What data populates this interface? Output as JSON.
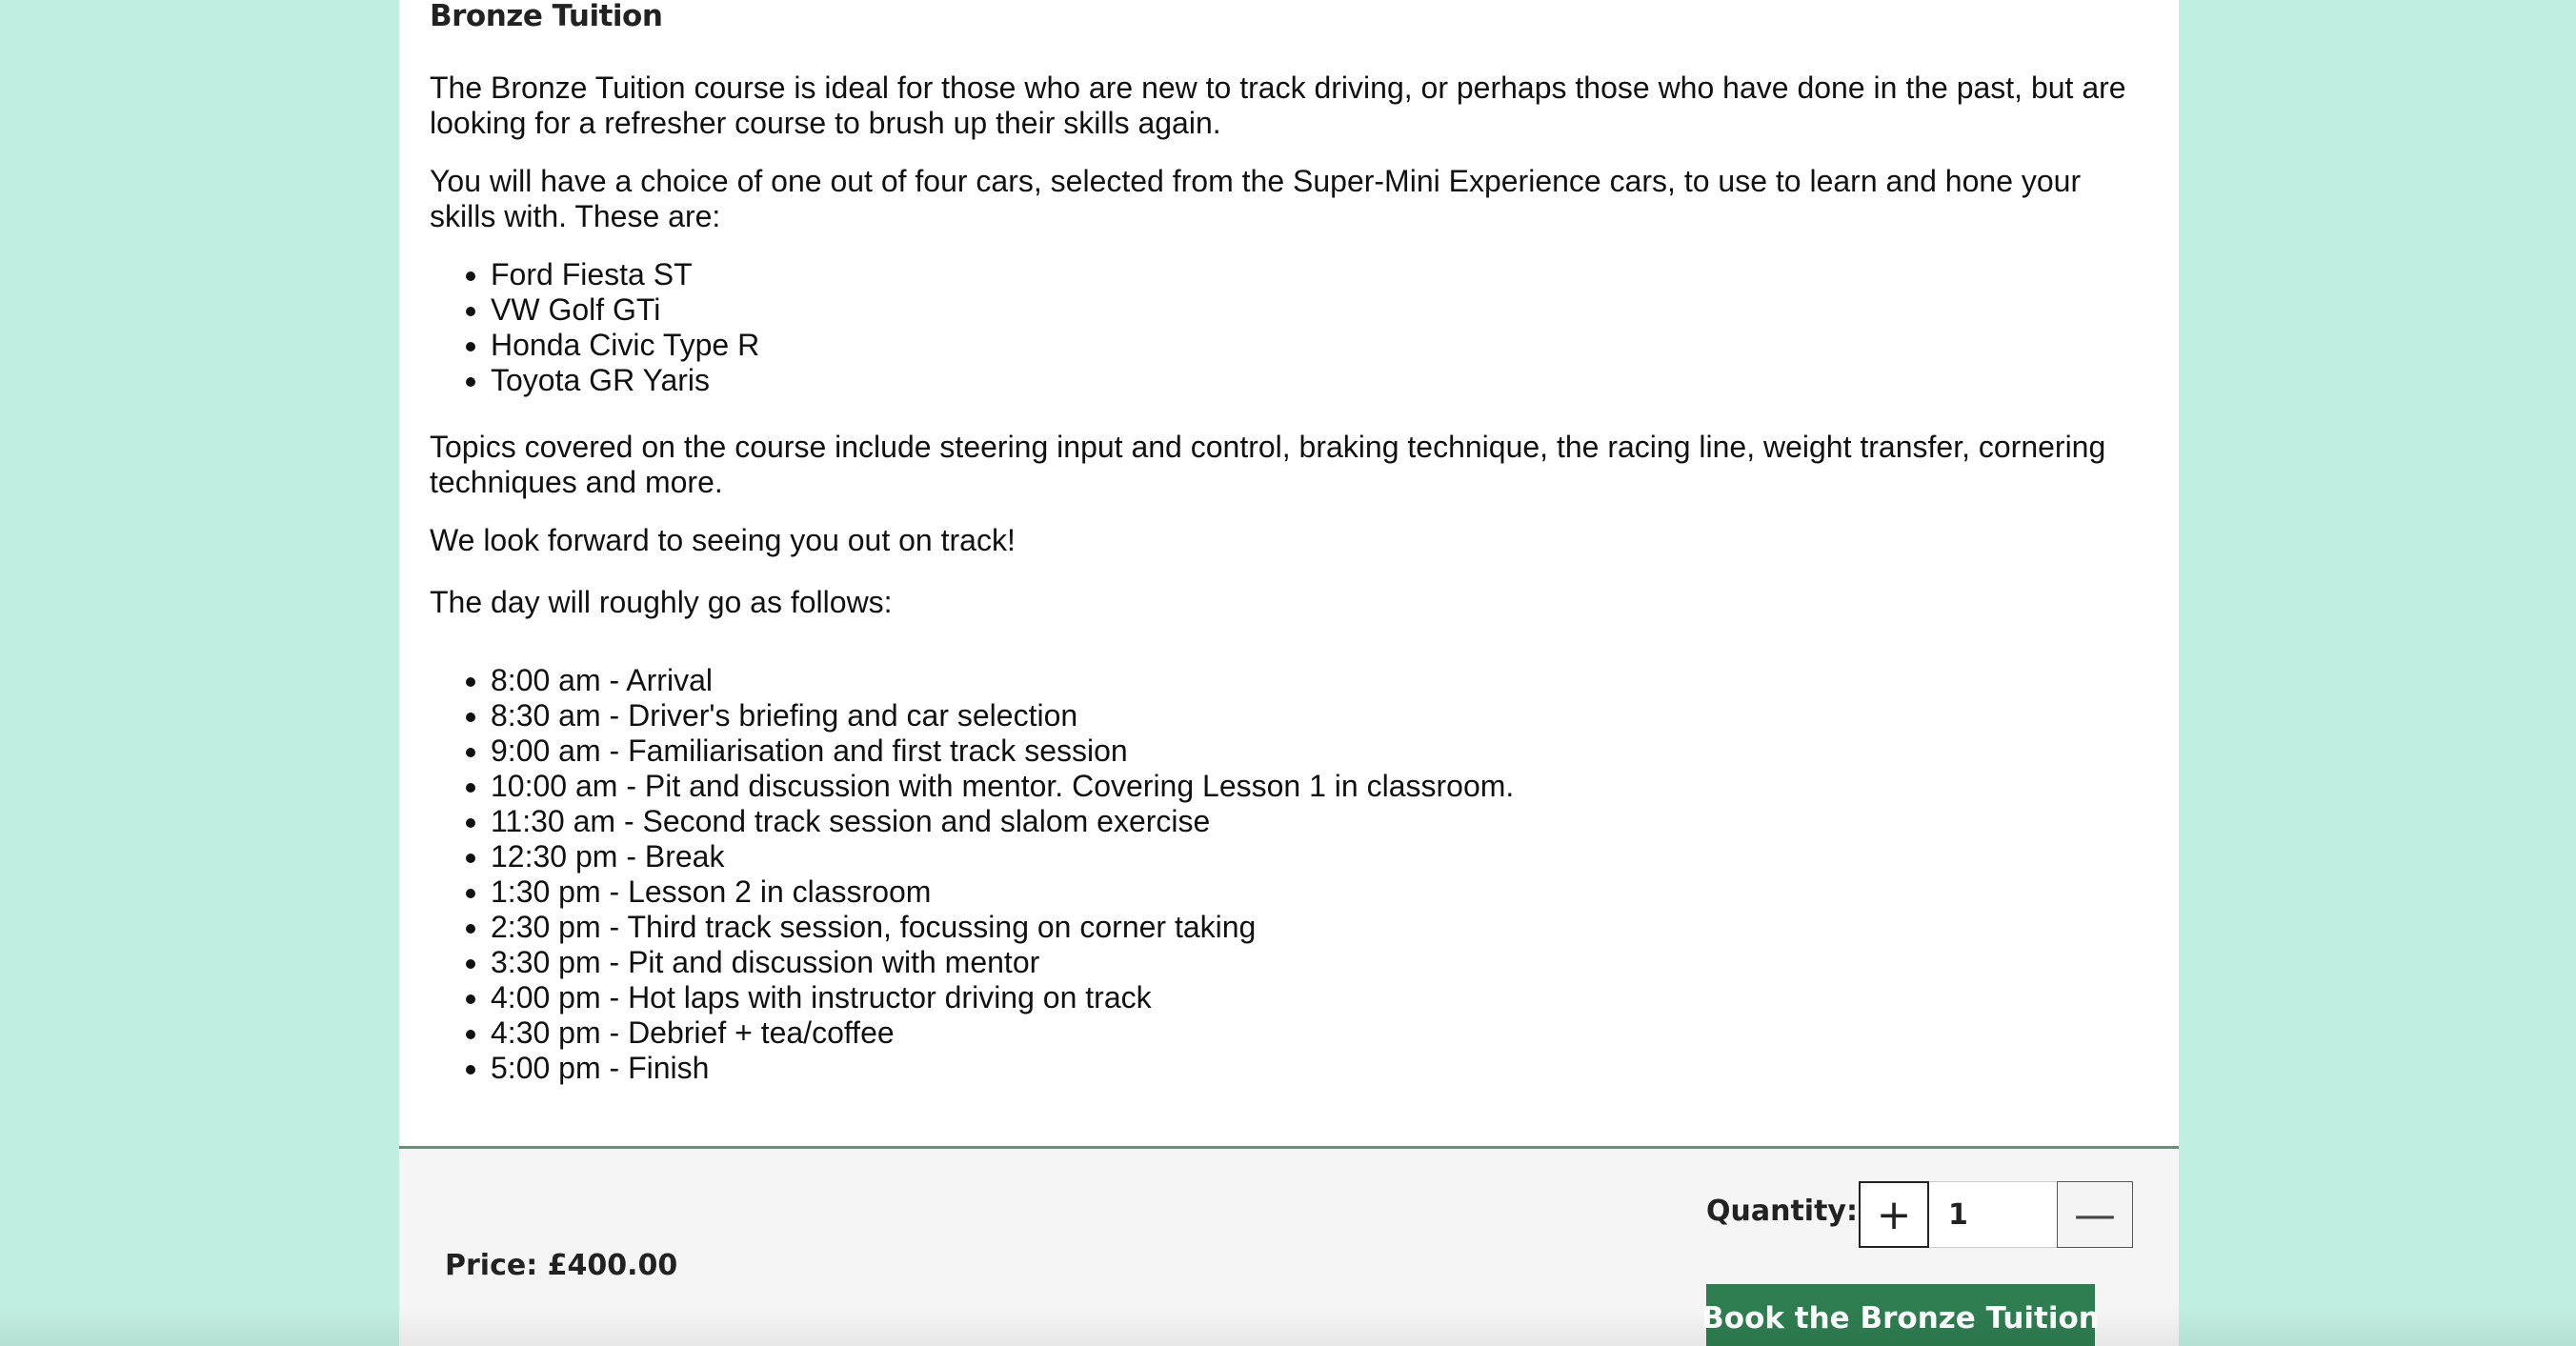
{
  "course": {
    "title": "Bronze Tuition",
    "intro": "The Bronze Tuition course is ideal for those who are new to track driving, or perhaps those who have done in the past, but are looking for a refresher course to brush up their skills again.",
    "cars_intro": "You will have a choice of one out of four cars, selected from the Super-Mini Experience cars, to use to learn and hone your skills with. These are:",
    "cars": [
      "Ford Fiesta ST",
      "VW Golf GTi",
      "Honda Civic Type R",
      "Toyota GR Yaris"
    ],
    "topics": "Topics covered on the course include steering input and control, braking technique, the racing line, weight transfer, cornering techniques and more.",
    "closing": "We look forward to seeing you out on track!",
    "schedule_intro": "The day will roughly go as follows:",
    "schedule": [
      "8:00 am - Arrival",
      "8:30 am - Driver's briefing and car selection",
      "9:00 am - Familiarisation and first track session",
      "10:00 am - Pit and discussion with mentor. Covering Lesson 1 in classroom.",
      "11:30 am - Second track session and slalom exercise",
      "12:30 pm - Break",
      "1:30 pm - Lesson 2 in classroom",
      "2:30 pm - Third track session, focussing on corner taking",
      "3:30 pm - Pit and discussion with mentor",
      "4:00 pm - Hot laps with instructor driving on track",
      "4:30 pm - Debrief + tea/coffee",
      "5:00 pm - Finish"
    ]
  },
  "purchase": {
    "price_label": "Price: £400.00",
    "quantity_label": "Quantity:",
    "plus_symbol": "+",
    "minus_symbol": "—",
    "quantity_value": "1",
    "book_label": "Book the Bronze Tuition"
  },
  "colors": {
    "page_background": "#c0eee0",
    "button_green": "#2e7d50",
    "divider_green": "#5e9474"
  }
}
